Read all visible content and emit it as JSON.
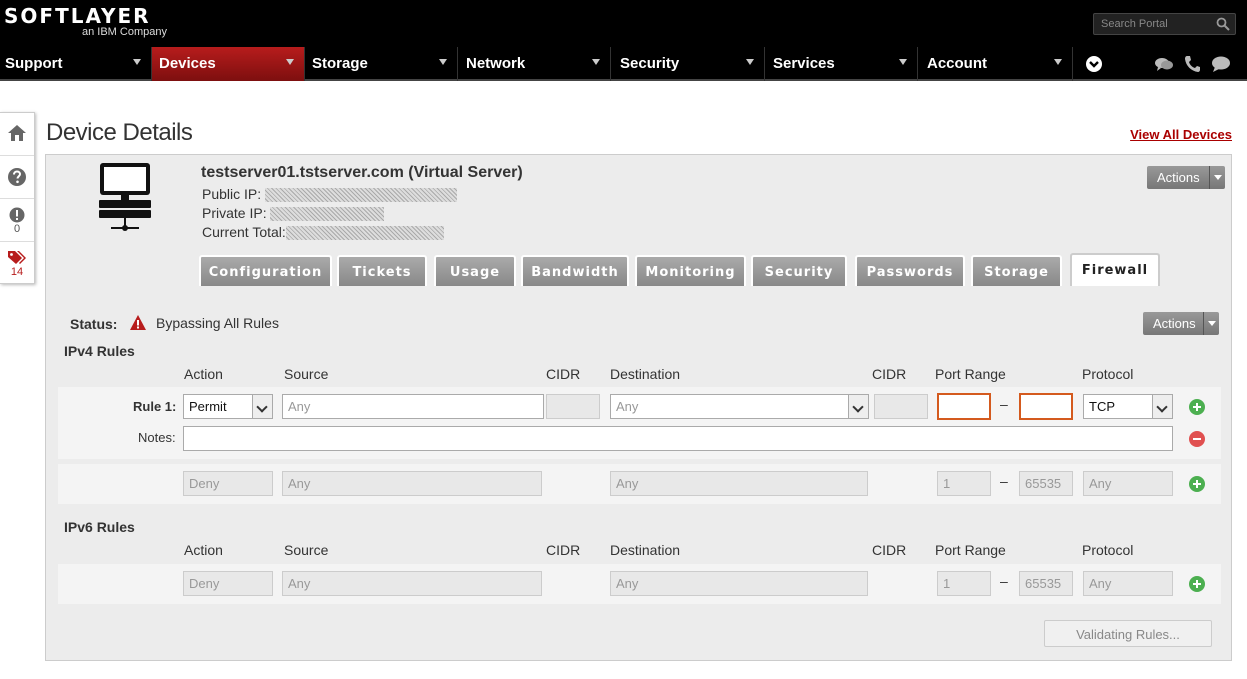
{
  "brand": {
    "name": "SOFTLAYER",
    "sub": "an IBM Company"
  },
  "search": {
    "placeholder": "Search Portal"
  },
  "nav": [
    {
      "label": "Support"
    },
    {
      "label": "Devices"
    },
    {
      "label": "Storage"
    },
    {
      "label": "Network"
    },
    {
      "label": "Security"
    },
    {
      "label": "Services"
    },
    {
      "label": "Account"
    }
  ],
  "sidebar": {
    "alerts_count": "0",
    "tags_count": "14"
  },
  "page": {
    "title": "Device Details",
    "view_all": "View All Devices"
  },
  "device": {
    "name": "testserver01.tstserver.com (Virtual Server)",
    "public_ip_label": "Public IP:",
    "private_ip_label": "Private IP:",
    "current_total_label": "Current Total:",
    "actions_label": "Actions"
  },
  "tabs": [
    {
      "label": "Configuration"
    },
    {
      "label": "Tickets"
    },
    {
      "label": "Usage"
    },
    {
      "label": "Bandwidth"
    },
    {
      "label": "Monitoring"
    },
    {
      "label": "Security"
    },
    {
      "label": "Passwords"
    },
    {
      "label": "Storage"
    },
    {
      "label": "Firewall"
    }
  ],
  "firewall": {
    "status_label": "Status:",
    "status_value": "Bypassing All Rules",
    "actions_label": "Actions",
    "columns": {
      "action": "Action",
      "source": "Source",
      "cidr": "CIDR",
      "destination": "Destination",
      "cidr2": "CIDR",
      "port_range": "Port Range",
      "protocol": "Protocol"
    },
    "ipv4_title": "IPv4 Rules",
    "ipv6_title": "IPv6 Rules",
    "rule1": {
      "label": "Rule 1:",
      "action": "Permit",
      "source_placeholder": "Any",
      "destination_placeholder": "Any",
      "protocol": "TCP",
      "notes_label": "Notes:",
      "dash": "–"
    },
    "ipv4_default": {
      "action": "Deny",
      "source": "Any",
      "destination": "Any",
      "port_from": "1",
      "port_to": "65535",
      "protocol": "Any",
      "dash": "–"
    },
    "ipv6_default": {
      "action": "Deny",
      "source": "Any",
      "destination": "Any",
      "port_from": "1",
      "port_to": "65535",
      "protocol": "Any",
      "dash": "–"
    },
    "validate_label": "Validating Rules..."
  }
}
